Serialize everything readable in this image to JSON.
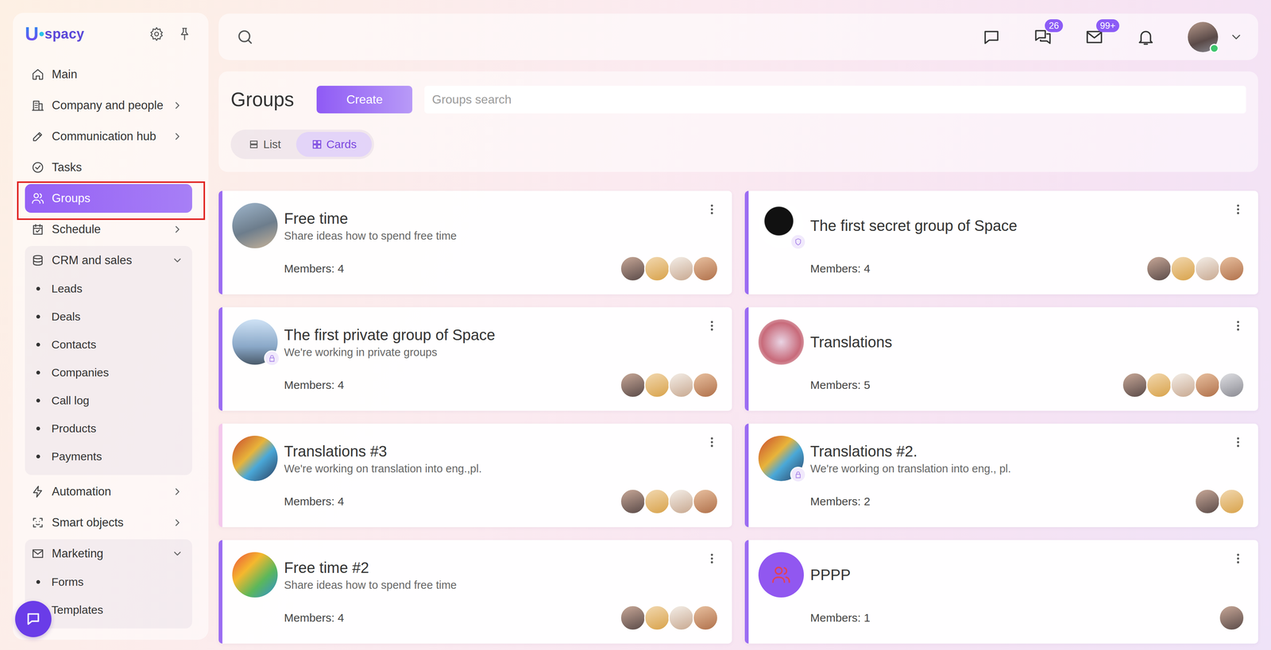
{
  "sidebar": {
    "logo": {
      "mark": "U",
      "text": "spacy"
    },
    "items": [
      {
        "label": "Main",
        "selected": false,
        "outlined": false,
        "expandable": false,
        "expanded": false,
        "children": []
      },
      {
        "label": "Company and people",
        "selected": false,
        "outlined": false,
        "expandable": true,
        "expanded": false,
        "children": []
      },
      {
        "label": "Communication hub",
        "selected": false,
        "outlined": false,
        "expandable": true,
        "expanded": false,
        "children": []
      },
      {
        "label": "Tasks",
        "selected": false,
        "outlined": false,
        "expandable": false,
        "expanded": false,
        "children": []
      },
      {
        "label": "Groups",
        "selected": true,
        "outlined": true,
        "expandable": false,
        "expanded": false,
        "children": []
      },
      {
        "label": "Schedule",
        "selected": false,
        "outlined": false,
        "expandable": true,
        "expanded": false,
        "children": []
      },
      {
        "label": "CRM and sales",
        "selected": false,
        "outlined": false,
        "expandable": true,
        "expanded": true,
        "children": [
          "Leads",
          "Deals",
          "Contacts",
          "Companies",
          "Call log",
          "Products",
          "Payments"
        ]
      },
      {
        "label": "Automation",
        "selected": false,
        "outlined": false,
        "expandable": true,
        "expanded": false,
        "children": []
      },
      {
        "label": "Smart objects",
        "selected": false,
        "outlined": false,
        "expandable": true,
        "expanded": false,
        "children": []
      },
      {
        "label": "Marketing",
        "selected": false,
        "outlined": false,
        "expandable": true,
        "expanded": true,
        "children": [
          "Forms",
          "Templates"
        ]
      }
    ]
  },
  "topbar": {
    "actions": [
      {
        "badge": ""
      },
      {
        "badge": "26"
      },
      {
        "badge": "99+"
      },
      {
        "badge": ""
      }
    ],
    "user": {
      "online": true
    }
  },
  "page": {
    "title": "Groups",
    "create_button": "Create",
    "search_placeholder": "Groups search",
    "views": [
      {
        "label": "List",
        "selected": false
      },
      {
        "label": "Cards",
        "selected": true
      }
    ]
  },
  "cards": [
    {
      "name": "Free time",
      "description": "Share ideas how to spend free time",
      "members": "Members: 4",
      "member_avatars": 4,
      "privacy": "none",
      "image": "photo",
      "color": "#9b6cf2"
    },
    {
      "name": "The first secret group of Space",
      "description": "",
      "members": "Members: 4",
      "member_avatars": 4,
      "privacy": "secret",
      "image": "photo",
      "color": "#9b6cf2"
    },
    {
      "name": "The first private group of Space",
      "description": "We're working in private groups",
      "members": "Members: 4",
      "member_avatars": 4,
      "privacy": "private",
      "image": "photo",
      "color": "#9b6cf2"
    },
    {
      "name": "Translations",
      "description": "",
      "members": "Members: 5",
      "member_avatars": 5,
      "privacy": "none",
      "image": "photo",
      "color": "#9b6cf2"
    },
    {
      "name": "Translations #3",
      "description": "We're working on translation into eng.,pl.",
      "members": "Members: 4",
      "member_avatars": 4,
      "privacy": "none",
      "image": "photo",
      "color": "#f4c8ec"
    },
    {
      "name": "Translations #2.",
      "description": "We're working on translation into eng., pl.",
      "members": "Members: 2",
      "member_avatars": 2,
      "privacy": "private",
      "image": "photo",
      "color": "#9b6cf2"
    },
    {
      "name": "Free time #2",
      "description": "Share ideas how to spend free time",
      "members": "Members: 4",
      "member_avatars": 4,
      "privacy": "none",
      "image": "photo",
      "color": "#9b6cf2"
    },
    {
      "name": "PPPP",
      "description": "",
      "members": "Members: 1",
      "member_avatars": 1,
      "privacy": "none",
      "image": "icon",
      "color": "#9b6cf2"
    }
  ]
}
